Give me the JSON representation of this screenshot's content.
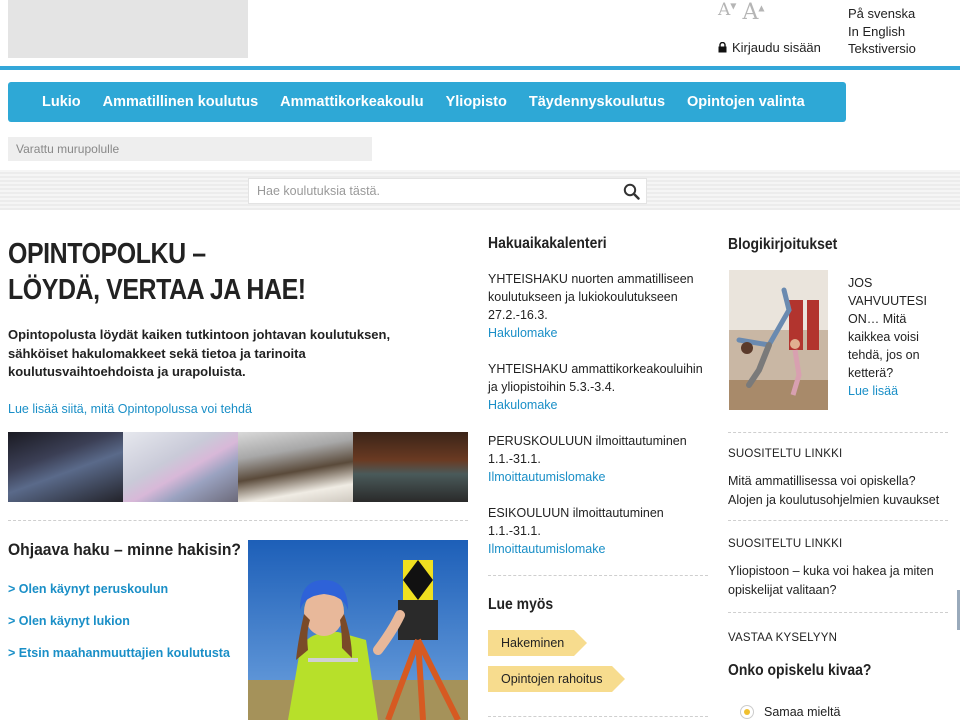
{
  "header": {
    "font_small": "A",
    "font_large": "A",
    "login": "Kirjaudu sisään",
    "languages": [
      "På svenska",
      "In English",
      "Tekstiversio"
    ]
  },
  "nav": {
    "items": [
      "Lukio",
      "Ammatillinen koulutus",
      "Ammattikorkeakoulu",
      "Yliopisto",
      "Täydennyskoulutus",
      "Opintojen valinta"
    ]
  },
  "breadcrumb": "Varattu murupolulle",
  "search": {
    "placeholder": "Hae koulutuksia tästä."
  },
  "main": {
    "headline_line1": "OPINTOPOLKU –",
    "headline_line2": "LÖYDÄ, VERTAA JA HAE!",
    "intro": "Opintopolusta löydät kaiken tutkintoon johtavan koulutuksen, sähköiset hakulomakkeet sekä tietoa ja tarinoita koulutusvaihtoehdoista ja urapoluista.",
    "intro_link": "Lue lisää siitä, mitä Opintopolussa voi tehdä"
  },
  "guided": {
    "title": "Ohjaava haku – minne hakisin?",
    "links": [
      "> Olen käynyt peruskoulun",
      "> Olen käynyt lukion",
      "> Etsin maahanmuuttajien koulutusta"
    ]
  },
  "calendar": {
    "title": "Hakuaikakalenteri",
    "items": [
      {
        "text": "YHTEISHAKU nuorten ammatilliseen koulutukseen ja lukiokoulutukseen 27.2.-16.3.",
        "link": "Hakulomake"
      },
      {
        "text": "YHTEISHAKU ammattikorkeakouluihin ja yliopistoihin 5.3.-3.4.",
        "link": "Hakulomake"
      },
      {
        "text": "PERUSKOULUUN ilmoittautuminen 1.1.-31.1.",
        "link": "Ilmoittautumislomake"
      },
      {
        "text": "ESIKOULUUN  ilmoittautuminen 1.1.-31.1.",
        "link": "Ilmoittautumislomake"
      }
    ]
  },
  "read_also": {
    "title": "Lue myös",
    "tags": [
      "Hakeminen",
      "Opintojen rahoitus"
    ]
  },
  "blog": {
    "title": "Blogikirjoitukset",
    "text": "JOS VAHVUUTESI ON… Mitä kaikkea voisi tehdä, jos on ketterä?",
    "link": "Lue lisää"
  },
  "recommended": [
    {
      "head": "SUOSITELTU LINKKI",
      "text": "Mitä ammatillisessa voi opiskella? Alojen ja koulutusohjelmien kuvaukset"
    },
    {
      "head": "SUOSITELTU LINKKI",
      "text": "Yliopistoon – kuka voi hakea ja miten opiskelijat valitaan?"
    }
  ],
  "poll": {
    "head": "VASTAA KYSELYYN",
    "question": "Onko opiskelu kivaa?",
    "option": "Samaa mieltä"
  },
  "colors": {
    "accent": "#2ea8d6",
    "link": "#1a8fc7",
    "tag": "#f7dc8e"
  }
}
